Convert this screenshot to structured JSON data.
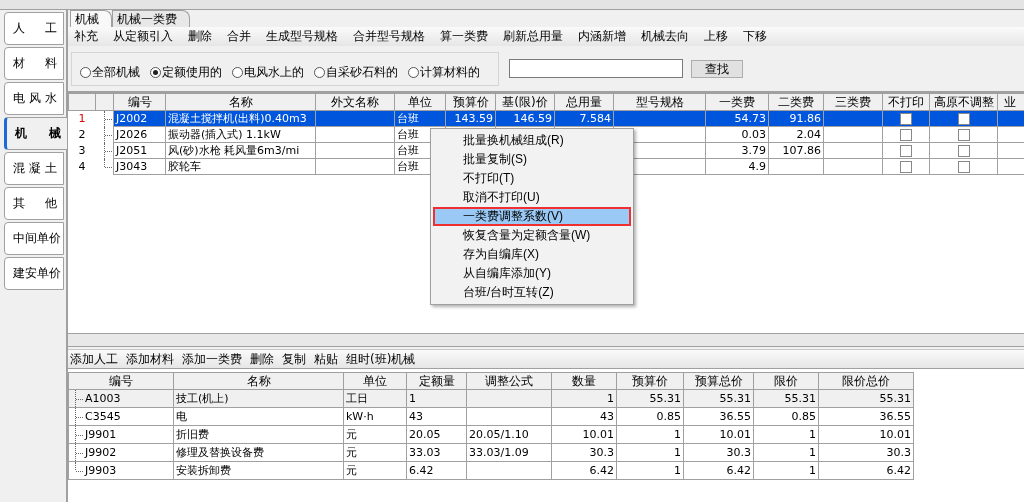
{
  "sidebar": {
    "items": [
      {
        "label": "人 工",
        "selected": false
      },
      {
        "label": "材 料",
        "selected": false
      },
      {
        "label": "电 风 水",
        "selected": false
      },
      {
        "label": "机 械",
        "selected": true
      },
      {
        "label": "混 凝 土",
        "selected": false
      },
      {
        "label": "其 他",
        "selected": false
      },
      {
        "label": "中间单价",
        "selected": false
      },
      {
        "label": "建安单价",
        "selected": false
      }
    ]
  },
  "tabs": [
    {
      "label": "机械",
      "selected": true
    },
    {
      "label": "机械一类费",
      "selected": false
    }
  ],
  "toolbar": [
    "补充",
    "从定额引入",
    "删除",
    "合并",
    "生成型号规格",
    "合并型号规格",
    "算一类费",
    "刷新总用量",
    "内涵新增",
    "机械去向",
    "上移",
    "下移"
  ],
  "filter": {
    "options": [
      {
        "label": "全部机械",
        "selected": false
      },
      {
        "label": "定额使用的",
        "selected": true
      },
      {
        "label": "电风水上的",
        "selected": false
      },
      {
        "label": "自采砂石料的",
        "selected": false
      },
      {
        "label": "计算材料的",
        "selected": false
      }
    ],
    "search_button": "查找"
  },
  "grid": {
    "columns": [
      {
        "label": "编号",
        "kind": "text"
      },
      {
        "label": "名称",
        "kind": "text"
      },
      {
        "label": "外文名称",
        "kind": "text"
      },
      {
        "label": "单位",
        "kind": "text"
      },
      {
        "label": "预算价",
        "kind": "number"
      },
      {
        "label": "基(限)价",
        "kind": "number"
      },
      {
        "label": "总用量",
        "kind": "number"
      },
      {
        "label": "型号规格",
        "kind": "text"
      },
      {
        "label": "一类费",
        "kind": "number"
      },
      {
        "label": "二类费",
        "kind": "number"
      },
      {
        "label": "三类费",
        "kind": "number"
      },
      {
        "label": "不打印",
        "kind": "check"
      },
      {
        "label": "高原不调整",
        "kind": "check"
      },
      {
        "label": "业",
        "kind": "check"
      }
    ],
    "rows": [
      {
        "num": "1",
        "selected": true,
        "cells": [
          "J2002",
          "混凝土搅拌机(出料)0.40m3",
          null,
          "台班",
          "143.59",
          "146.59",
          "7.584",
          null,
          "54.73",
          "91.86",
          null,
          false,
          false
        ]
      },
      {
        "num": "2",
        "selected": false,
        "cells": [
          "J2026",
          "振动器(插入式)  1.1kW",
          null,
          "台班",
          null,
          null,
          null,
          null,
          "0.03",
          "2.04",
          null,
          false,
          false
        ]
      },
      {
        "num": "3",
        "selected": false,
        "cells": [
          "J2051",
          "风(砂)水枪  耗风量6m3/mi",
          null,
          "台班",
          null,
          null,
          null,
          null,
          "3.79",
          "107.86",
          null,
          false,
          false
        ]
      },
      {
        "num": "4",
        "selected": false,
        "cells": [
          "J3043",
          "胶轮车",
          null,
          "台班",
          null,
          null,
          null,
          null,
          "4.9",
          null,
          null,
          false,
          false
        ]
      }
    ]
  },
  "context_menu": {
    "items": [
      {
        "label": "批量换机械组成(R)",
        "selected": false
      },
      {
        "label": "批量复制(S)",
        "selected": false
      },
      {
        "label": "不打印(T)",
        "selected": false
      },
      {
        "label": "取消不打印(U)",
        "selected": false
      },
      {
        "label": "一类费调整系数(V)",
        "selected": true
      },
      {
        "label": "恢复含量为定额含量(W)",
        "selected": false
      },
      {
        "label": "存为自编库(X)",
        "selected": false
      },
      {
        "label": "从自编库添加(Y)",
        "selected": false
      },
      {
        "label": "台班/台时互转(Z)",
        "selected": false
      }
    ]
  },
  "bottom_toolbar": [
    "添加人工",
    "添加材料",
    "添加一类费",
    "删除",
    "复制",
    "粘贴",
    "组时(班)机械"
  ],
  "detail": {
    "columns": [
      {
        "label": "编号",
        "kind": "text"
      },
      {
        "label": "名称",
        "kind": "text"
      },
      {
        "label": "单位",
        "kind": "text"
      },
      {
        "label": "定额量",
        "kind": "text"
      },
      {
        "label": "调整公式",
        "kind": "text"
      },
      {
        "label": "数量",
        "kind": "number"
      },
      {
        "label": "预算价",
        "kind": "number"
      },
      {
        "label": "预算总价",
        "kind": "number"
      },
      {
        "label": "限价",
        "kind": "number"
      },
      {
        "label": "限价总价",
        "kind": "number"
      }
    ],
    "rows": [
      {
        "selected": true,
        "cells": [
          "A1003",
          "技工(机上)",
          "工日",
          "1",
          null,
          "1",
          "55.31",
          "55.31",
          "55.31",
          "55.31"
        ]
      },
      {
        "selected": false,
        "cells": [
          "C3545",
          "电",
          "kW·h",
          "43",
          null,
          "43",
          "0.85",
          "36.55",
          "0.85",
          "36.55"
        ]
      },
      {
        "selected": false,
        "cells": [
          "J9901",
          "折旧费",
          "元",
          "20.05",
          "20.05/1.10",
          "10.01",
          "1",
          "10.01",
          "1",
          "10.01"
        ]
      },
      {
        "selected": false,
        "cells": [
          "J9902",
          "修理及替换设备费",
          "元",
          "33.03",
          "33.03/1.09",
          "30.3",
          "1",
          "30.3",
          "1",
          "30.3"
        ]
      },
      {
        "selected": false,
        "cells": [
          "J9903",
          "安装拆卸费",
          "元",
          "6.42",
          null,
          "6.42",
          "1",
          "6.42",
          "1",
          "6.42"
        ]
      }
    ]
  }
}
